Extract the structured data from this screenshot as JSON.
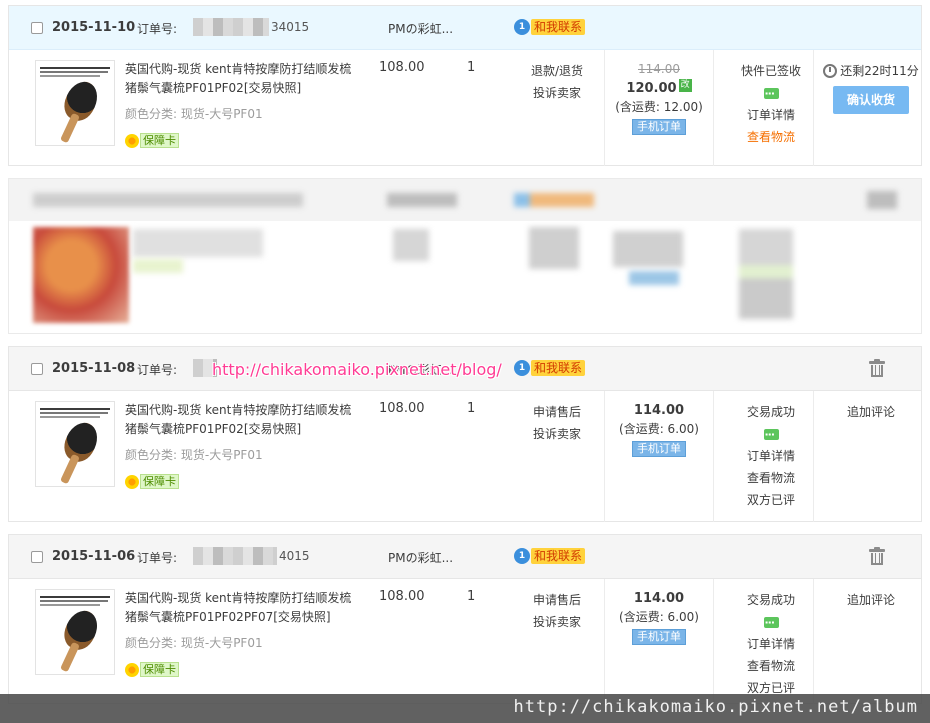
{
  "orders": [
    {
      "date": "2015-11-10",
      "order_no_label": "订单号:",
      "order_no_tail": "34015",
      "shop": "PMの彩虹...",
      "contact_label": "和我联系",
      "contact_badge": "1",
      "title": "英国代购-现货 kent肯特按摩防打结顺发梳猪鬃气囊梳PF01PF02[交易快照]",
      "sku": "颜色分类:  现货-大号PF01",
      "guarantee": "保障卡",
      "price": "108.00",
      "qty": "1",
      "ops": [
        "退款/退货",
        "投诉卖家"
      ],
      "old_total": "114.00",
      "total": "120.00",
      "edited_mark": "改",
      "shipping": "(含运费: 12.00)",
      "mobile": "手机订单",
      "status": [
        "快件已签收",
        "订单详情",
        "查看物流"
      ],
      "timer": "还剩22时11分",
      "action": "确认收货"
    },
    {
      "date": "2015-11-08",
      "order_no_label": "订单号:",
      "order_no_tail": "",
      "shop": "PMの彩虹...",
      "contact_label": "和我联系",
      "contact_badge": "1",
      "title": "英国代购-现货 kent肯特按摩防打结顺发梳猪鬃气囊梳PF01PF02[交易快照]",
      "sku": "颜色分类:  现货-大号PF01",
      "guarantee": "保障卡",
      "price": "108.00",
      "qty": "1",
      "ops": [
        "申请售后",
        "投诉卖家"
      ],
      "total": "114.00",
      "shipping": "(含运费: 6.00)",
      "mobile": "手机订单",
      "status": [
        "交易成功",
        "订单详情",
        "查看物流",
        "双方已评"
      ],
      "action": "追加评论"
    },
    {
      "date": "2015-11-06",
      "order_no_label": "订单号:",
      "order_no_tail": "4015",
      "shop": "PMの彩虹...",
      "contact_label": "和我联系",
      "contact_badge": "1",
      "title": "英国代购-现货 kent肯特按摩防打结顺发梳猪鬃气囊梳PF01PF02PF07[交易快照]",
      "sku": "颜色分类:  现货-大号PF01",
      "guarantee": "保障卡",
      "price": "108.00",
      "qty": "1",
      "ops": [
        "申请售后",
        "投诉卖家"
      ],
      "total": "114.00",
      "shipping": "(含运费: 6.00)",
      "mobile": "手机订单",
      "status": [
        "交易成功",
        "订单详情",
        "查看物流",
        "双方已评"
      ],
      "action": "追加评论"
    }
  ],
  "watermark_inline": "http://chikakomaiko.pixnet.net/blog/",
  "watermark_footer": "http://chikakomaiko.pixnet.net/album",
  "colors": {
    "header_blue": "#eaf8ff",
    "header_gray": "#f5f5f5",
    "confirm_button": "#77b9f2",
    "logistics_link": "#f56f00",
    "contact_badge": "#ffd23c",
    "watermark": "#ff3c94"
  }
}
